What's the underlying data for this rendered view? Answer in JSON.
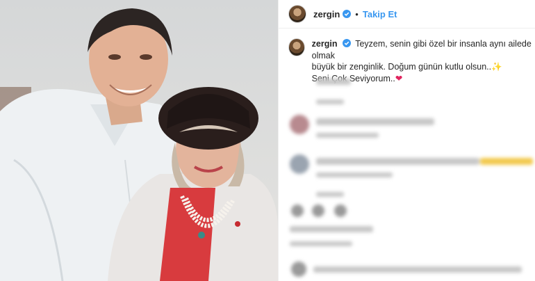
{
  "post": {
    "username": "zergin",
    "follow_label": "Takip Et",
    "separator": "•",
    "caption_line1": "Teyzem, senin gibi özel bir insanla aynı ailede olmak",
    "caption_line2": "büyük bir zenginlik. Doğum günün kutlu olsun..",
    "caption_line3": "Seni Çok Seviyorum..",
    "sparkle_emoji": "✨",
    "heart_emoji": "❤"
  },
  "colors": {
    "accent": "#3897f0",
    "verified": "#3897f0",
    "heart": "#e0245e"
  },
  "icons": [
    "verified-badge-icon",
    "heart-icon",
    "comment-icon",
    "share-icon",
    "bookmark-icon"
  ]
}
